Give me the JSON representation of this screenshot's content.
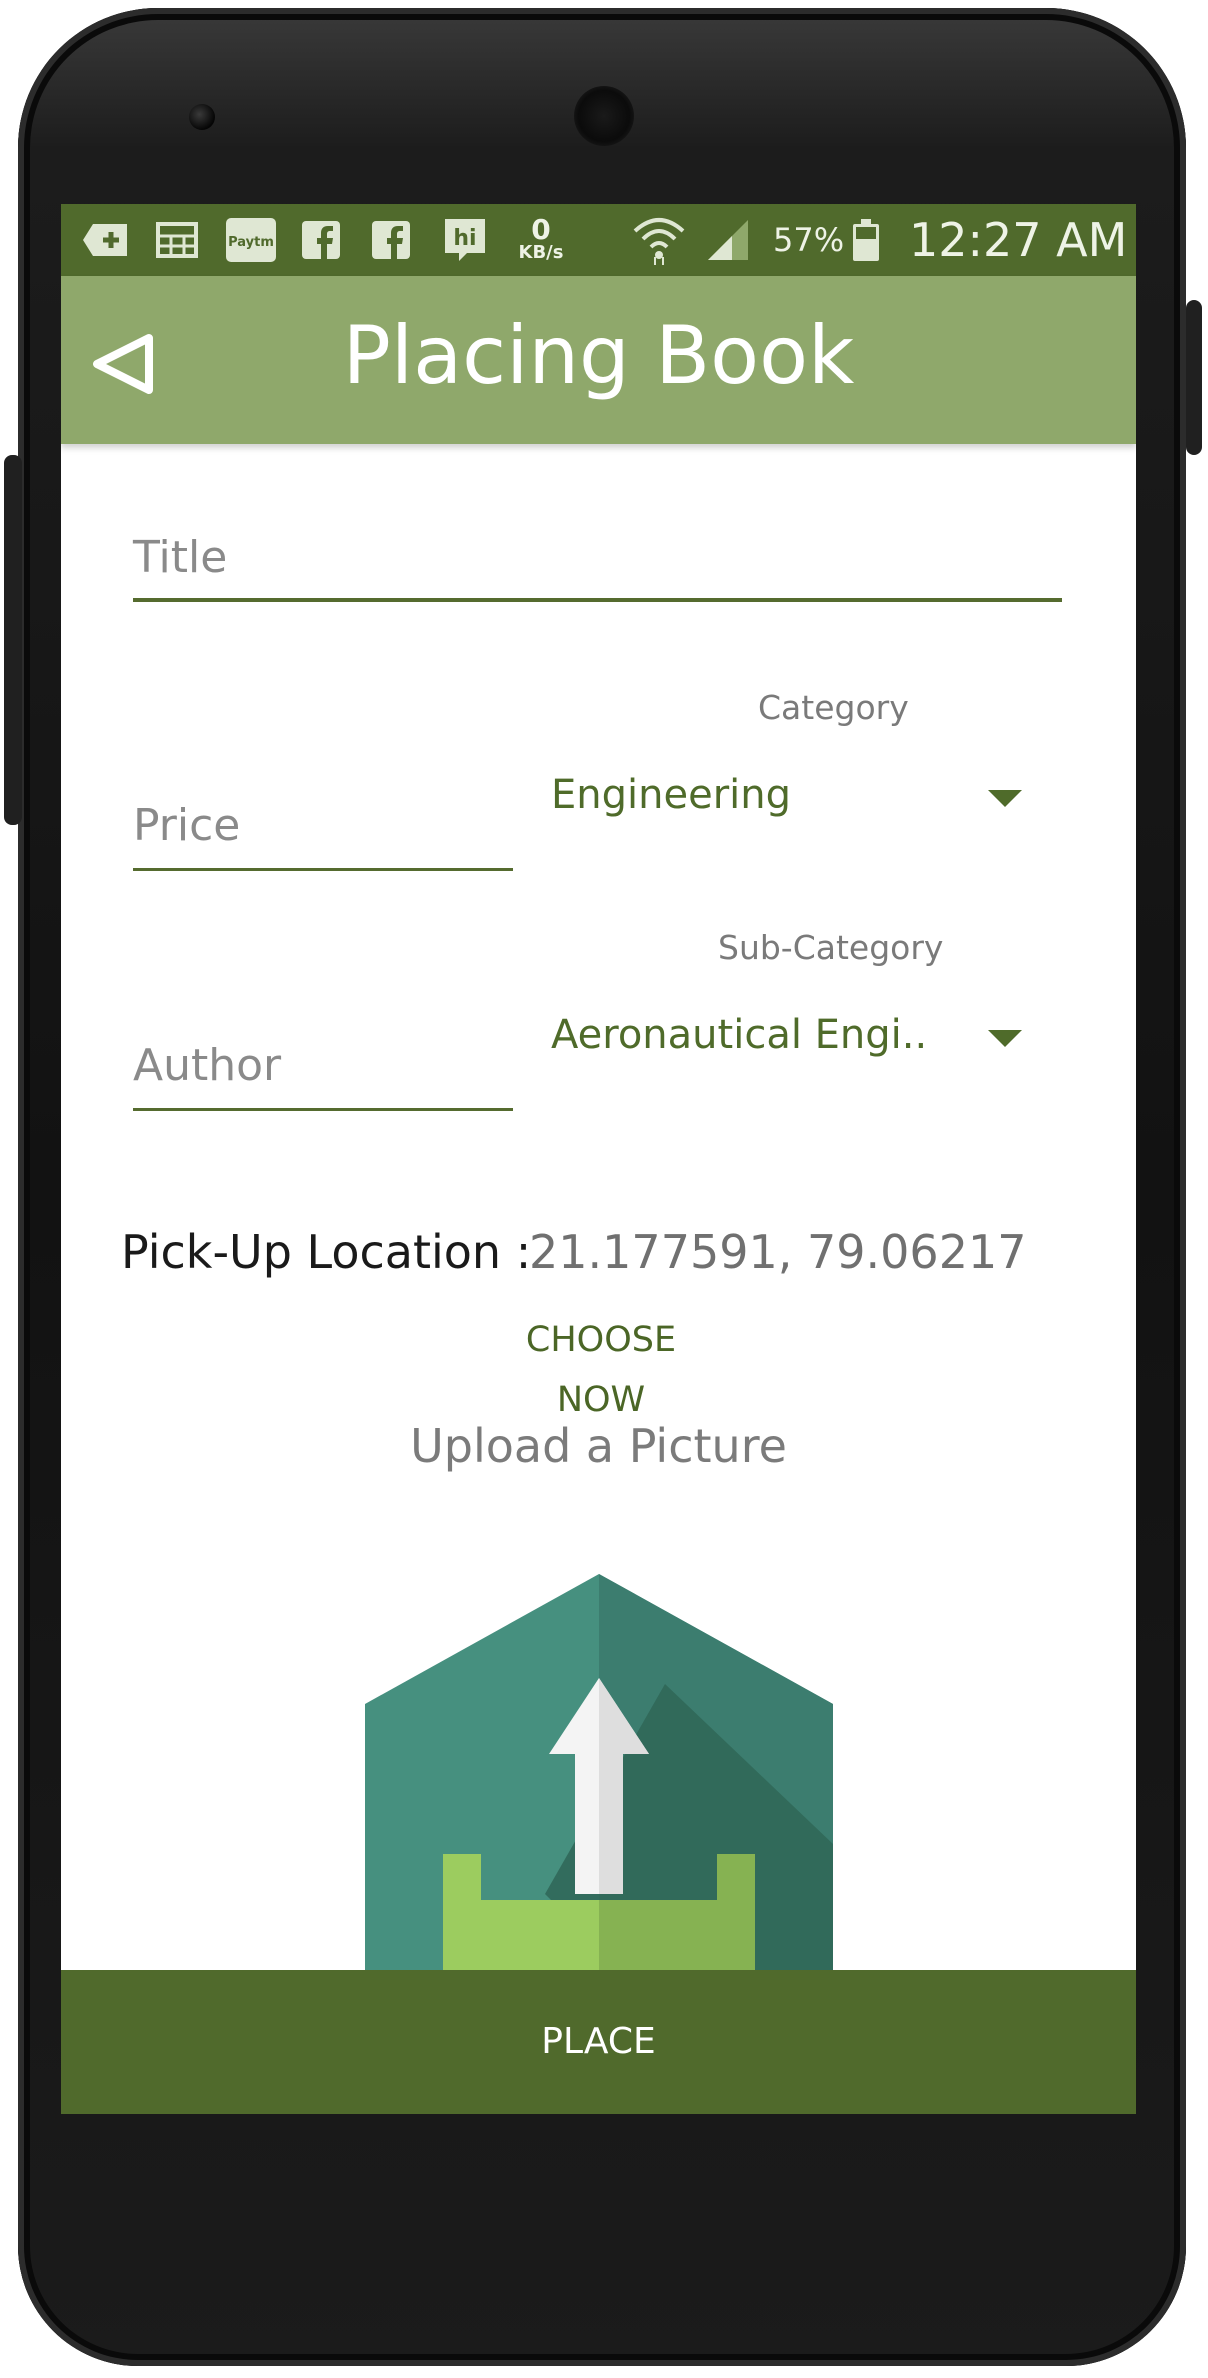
{
  "status_bar": {
    "network_speed_value": "0",
    "network_speed_unit": "KB/s",
    "battery": "57%",
    "time": "12:27 AM",
    "paytm_label": "Paytm",
    "hike_label": "hi",
    "icons": [
      "add-box-icon",
      "grid-app-icon",
      "paytm-icon",
      "facebook-icon",
      "facebook-icon",
      "hike-icon",
      "wifi-icon",
      "signal-icon",
      "battery-icon"
    ]
  },
  "app_bar": {
    "title": "Placing Book",
    "back_icon": "back-triangle-icon",
    "color": "#8fa86b"
  },
  "form": {
    "title_placeholder": "Title",
    "price_placeholder": "Price",
    "author_placeholder": "Author",
    "category": {
      "label": "Category",
      "selected": "Engineering"
    },
    "sub_category": {
      "label": "Sub-Category",
      "selected": "Aeronautical Engi.."
    },
    "pickup": {
      "label": "Pick-Up Location :",
      "value": "21.177591, 79.06217",
      "choose_label": "CHOOSE NOW"
    },
    "upload": {
      "label": "Upload a Picture",
      "icon": "upload-house-icon"
    }
  },
  "footer": {
    "place_label": "PLACE",
    "color": "#506a2c"
  }
}
